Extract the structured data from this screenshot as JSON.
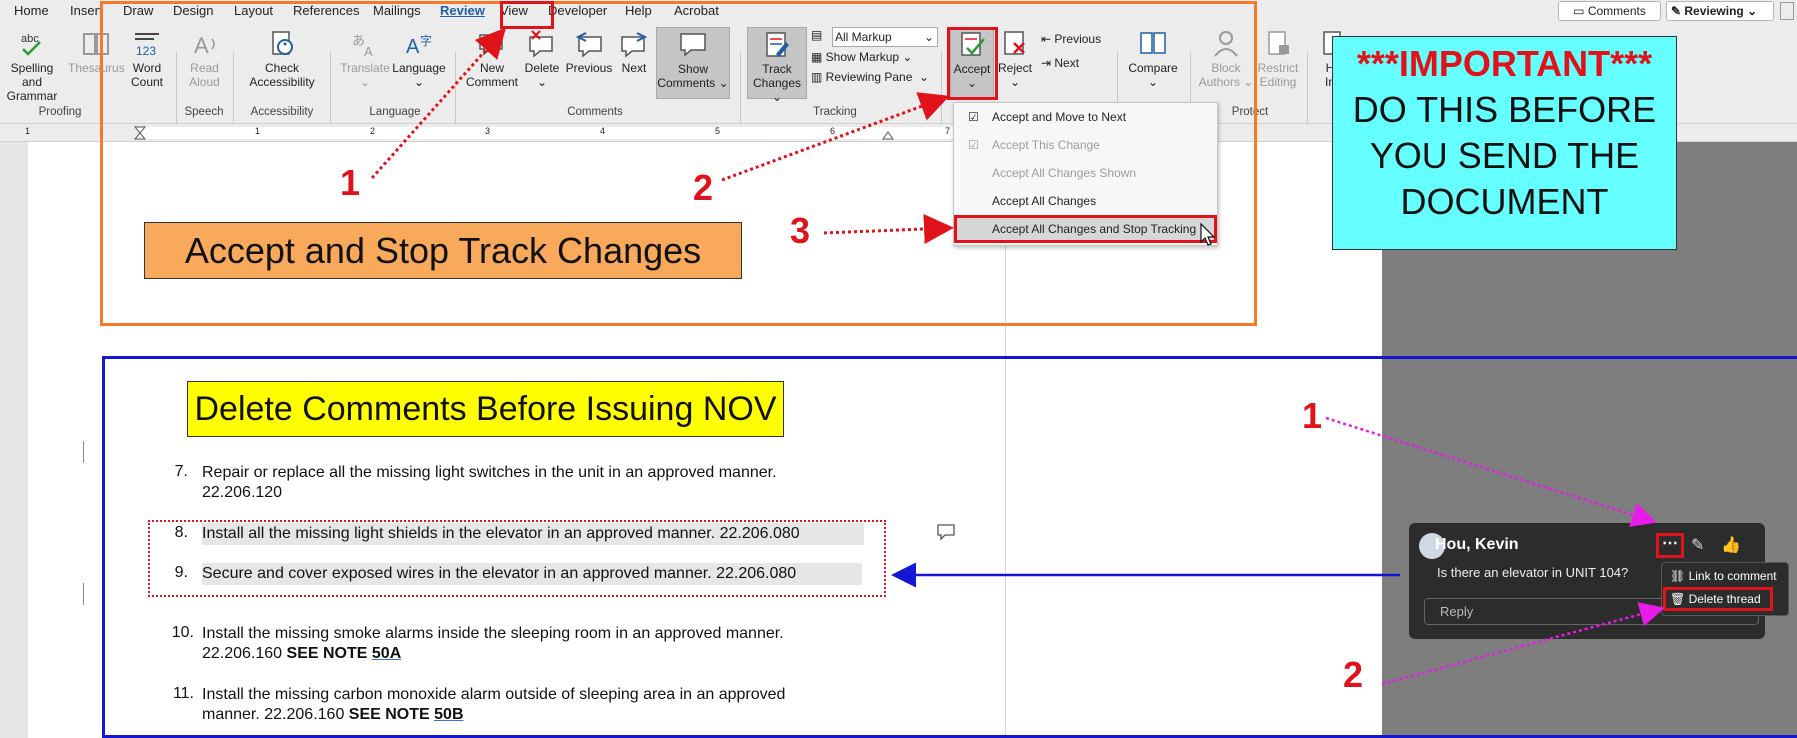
{
  "tabs": [
    "Home",
    "Insert",
    "Draw",
    "Design",
    "Layout",
    "References",
    "Mailings",
    "Review",
    "View",
    "Developer",
    "Help",
    "Acrobat"
  ],
  "top_right": {
    "comments": "Comments",
    "reviewing": "Reviewing"
  },
  "ribbon": {
    "spelling": "Spelling and Grammar",
    "thesaurus": "Thesaurus",
    "word_count": "Word Count",
    "read_aloud": "Read Aloud",
    "check_accessibility": "Check Accessibility",
    "translate": "Translate",
    "language": "Language",
    "new_comment": "New Comment",
    "delete": "Delete",
    "previous": "Previous",
    "next": "Next",
    "show_comments": "Show Comments",
    "track_changes": "Track Changes",
    "markup_select": "All Markup",
    "show_markup": "Show Markup",
    "reviewing_pane": "Reviewing Pane",
    "accept": "Accept",
    "reject": "Reject",
    "previous2": "Previous",
    "next2": "Next",
    "compare": "Compare",
    "block_authors": "Block Authors",
    "restrict_editing": "Restrict Editing",
    "hi": "H",
    "in": "In",
    "groups": {
      "proofing": "Proofing",
      "speech": "Speech",
      "accessibility": "Accessibility",
      "language": "Language",
      "comments": "Comments",
      "tracking": "Tracking",
      "protect": "Protect"
    }
  },
  "ruler_marks": [
    "1",
    "1",
    "2",
    "3",
    "4",
    "5",
    "6",
    "7"
  ],
  "dropdown": {
    "items": [
      {
        "label": "Accept and Move to Next",
        "enabled": true
      },
      {
        "label": "Accept This Change",
        "enabled": false
      },
      {
        "label": "Accept All Changes Shown",
        "enabled": false
      },
      {
        "label": "Accept All Changes",
        "enabled": true
      },
      {
        "label": "Accept All Changes and Stop Tracking",
        "enabled": true
      }
    ]
  },
  "callouts": {
    "track_title": "Accept and Stop Track Changes",
    "delete_title": "Delete Comments Before Issuing NOV",
    "important_line1": "***IMPORTANT***",
    "important_line2": "DO THIS BEFORE",
    "important_line3": "YOU SEND THE",
    "important_line4": "DOCUMENT",
    "n1": "1",
    "n2": "2",
    "n3": "3",
    "c1": "1",
    "c2": "2"
  },
  "document": {
    "items": [
      {
        "num": "7.",
        "line1": "Repair or replace all the missing light switches in the unit in an approved manner.",
        "line2": "22.206.120"
      },
      {
        "num": "8.",
        "line1": "Install all the missing light shields in the elevator in an approved manner.  22.206.080",
        "line2": ""
      },
      {
        "num": "9.",
        "line1": "Secure and cover exposed wires in the elevator in an approved manner.  22.206.080",
        "line2": ""
      },
      {
        "num": "10.",
        "line1": "Install the missing smoke alarms inside the sleeping room in an approved manner.",
        "line2": "22.206.160 ",
        "bold": "SEE NOTE ",
        "link": "50A"
      },
      {
        "num": "11.",
        "line1": "Install the missing carbon monoxide alarm outside of sleeping area in an approved",
        "line2": "manner.  22.206.160 ",
        "bold": "SEE NOTE ",
        "link": "50B"
      }
    ]
  },
  "comment": {
    "author": "Hou, Kevin",
    "text": "Is there an elevator in UNIT 104?",
    "reply_placeholder": "Reply",
    "menu_link": "Link to comment",
    "menu_delete": "Delete thread"
  },
  "colors": {
    "orange_box": "#f47a2a",
    "blue_box": "#1515d6",
    "important_bg": "#66ffff",
    "track_title_bg": "#f8a95c",
    "delete_title_bg": "#ffff00",
    "arrow_red": "#e0131b",
    "arrow_magenta": "#e81ce8",
    "arrow_blue": "#1515d6"
  }
}
